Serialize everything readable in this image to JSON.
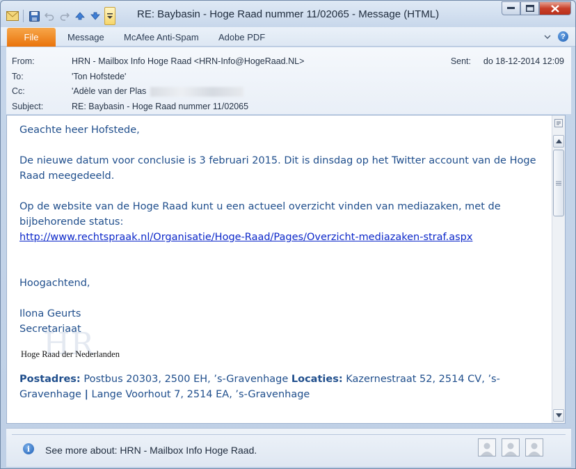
{
  "window": {
    "title": "RE: Baybasin - Hoge Raad nummer 11/02065  -  Message (HTML)"
  },
  "ribbon": {
    "tabs": [
      {
        "label": "File"
      },
      {
        "label": "Message"
      },
      {
        "label": "McAfee Anti-Spam"
      },
      {
        "label": "Adobe PDF"
      }
    ]
  },
  "header": {
    "from_label": "From:",
    "from_value": "HRN - Mailbox Info Hoge Raad <HRN-Info@HogeRaad.NL>",
    "to_label": "To:",
    "to_value": "'Ton Hofstede'",
    "cc_label": "Cc:",
    "cc_value": "'Adèle van der Plas",
    "subject_label": "Subject:",
    "subject_value": "RE: Baybasin - Hoge Raad nummer 11/02065",
    "sent_label": "Sent:",
    "sent_value": "do 18-12-2014 12:09"
  },
  "body": {
    "greeting": "Geachte heer Hofstede,",
    "para1": "De nieuwe datum voor conclusie is 3 februari 2015. Dit is dinsdag op het Twitter account van de Hoge Raad meegedeeld.",
    "para2": "Op de website van de Hoge Raad kunt u een actueel overzicht vinden van mediazaken, met de bijbehorende status:",
    "link": "http://www.rechtspraak.nl/Organisatie/Hoge-Raad/Pages/Overzicht-mediazaken-straf.aspx",
    "closing": "Hoogachtend,",
    "signature_name": "Ilona Geurts",
    "signature_role": "Secretariaat",
    "logo_mark": "HR",
    "logo_text": "Hoge Raad der Nederlanden",
    "postadres_label": "Postadres:",
    "postadres_value": " Postbus 20303, 2500 EH, ’s-Gravenhage ",
    "locaties_label": "Locaties:",
    "locaties_value": " Kazernestraat 52, 2514 CV, ’s-Gravenhage ",
    "locaties_sep": "|",
    "locaties_value2": " Lange Voorhout 7, 2514 EA, ’s-Gravenhage"
  },
  "people_pane": {
    "text": "See more about: HRN - Mailbox Info Hoge Raad."
  }
}
